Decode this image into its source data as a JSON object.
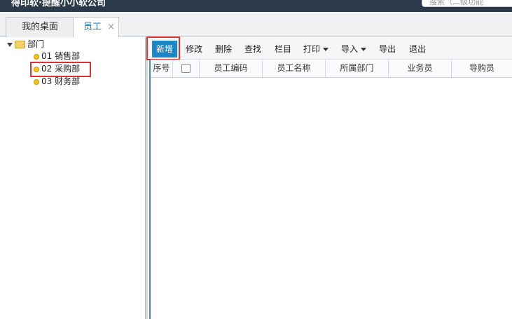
{
  "app": {
    "title": "得印软·提醒小小软公司",
    "search_placeholder": "搜索（二级功能"
  },
  "tabs": [
    {
      "label": "我的桌面",
      "closable": false
    },
    {
      "label": "员工",
      "closable": true,
      "close_glyph": "×"
    }
  ],
  "tree": {
    "root": "部门",
    "nodes": [
      "01 销售部",
      "02 采购部",
      "03 财务部"
    ]
  },
  "toolbar": {
    "add": "新增",
    "edit": "修改",
    "delete": "删除",
    "find": "查找",
    "columns": "栏目",
    "print": "打印",
    "import": "导入",
    "export": "导出",
    "exit": "退出"
  },
  "grid": {
    "columns": [
      "序号",
      "",
      "员工编码",
      "员工名称",
      "所属部门",
      "业务员",
      "导购员"
    ]
  },
  "colors": {
    "accent": "#1b86c8",
    "highlight": "#e03030",
    "topbar": "#2b3a4a"
  }
}
